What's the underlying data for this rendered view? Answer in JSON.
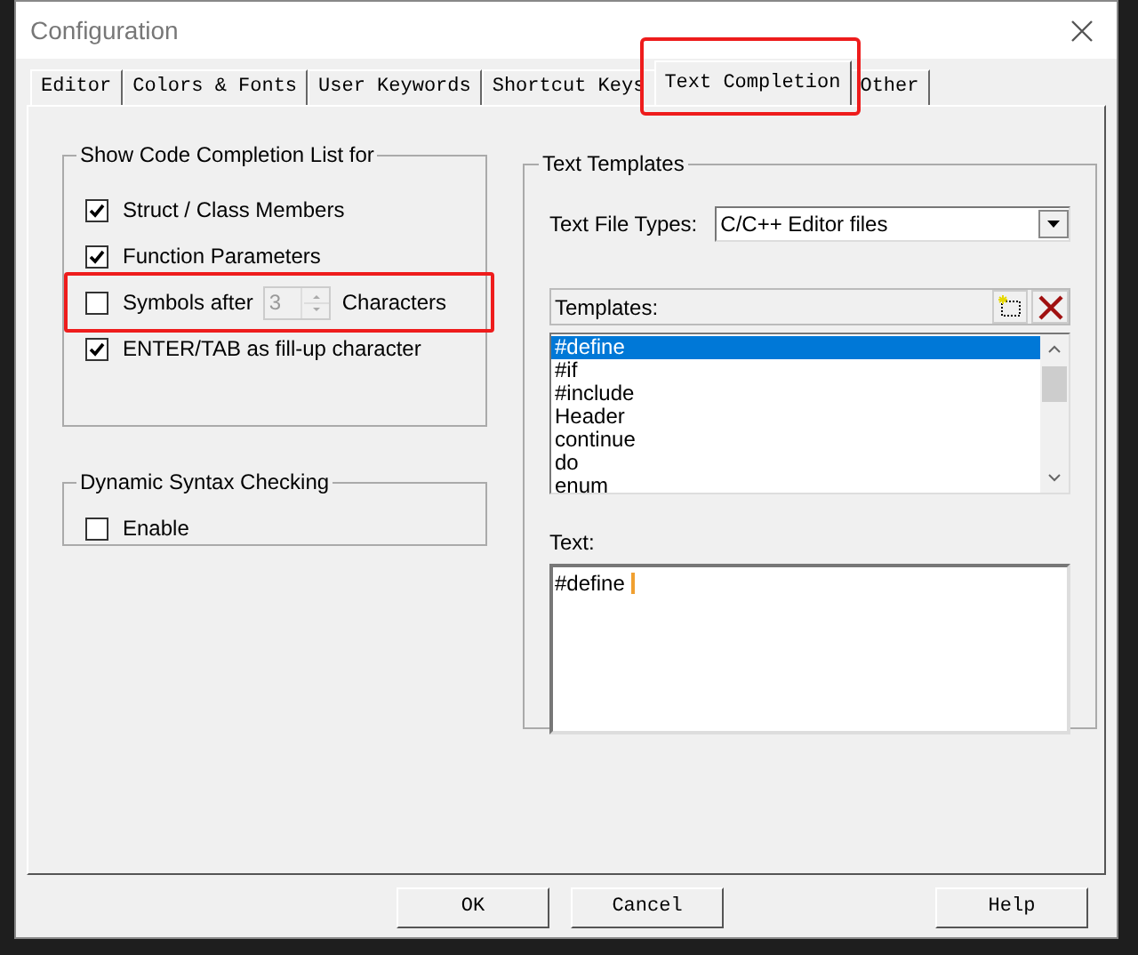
{
  "window": {
    "title": "Configuration"
  },
  "tabs": [
    {
      "label": "Editor",
      "selected": false,
      "highlighted": false
    },
    {
      "label": "Colors & Fonts",
      "selected": false,
      "highlighted": false
    },
    {
      "label": "User Keywords",
      "selected": false,
      "highlighted": false
    },
    {
      "label": "Shortcut Keys",
      "selected": false,
      "highlighted": false
    },
    {
      "label": "Text Completion",
      "selected": true,
      "highlighted": true
    },
    {
      "label": "Other",
      "selected": false,
      "highlighted": false
    }
  ],
  "code_completion": {
    "title": "Show Code Completion List for",
    "options": [
      {
        "kind": "checkbox",
        "label": "Struct / Class Members",
        "checked": true,
        "highlighted": false
      },
      {
        "kind": "checkbox",
        "label": "Function Parameters",
        "checked": true,
        "highlighted": false
      },
      {
        "kind": "spin",
        "label": "Symbols after",
        "value": "3",
        "suffix": "Characters",
        "checked": false,
        "disabled": true,
        "highlighted": true
      },
      {
        "kind": "checkbox",
        "label": "ENTER/TAB as fill-up character",
        "checked": true,
        "highlighted": false
      }
    ]
  },
  "syntax_checking": {
    "title": "Dynamic Syntax Checking",
    "options": [
      {
        "kind": "checkbox",
        "label": "Enable",
        "checked": false,
        "highlighted": false
      }
    ]
  },
  "text_templates": {
    "title": "Text Templates",
    "file_types": {
      "label": "Text File Types:",
      "value": "C/C++ Editor files"
    },
    "templates": {
      "label": "Templates:",
      "items": [
        {
          "label": "#define",
          "selected": true
        },
        {
          "label": "#if",
          "selected": false
        },
        {
          "label": "#include",
          "selected": false
        },
        {
          "label": "Header",
          "selected": false
        },
        {
          "label": "continue",
          "selected": false
        },
        {
          "label": "do",
          "selected": false
        },
        {
          "label": "enum",
          "selected": false
        }
      ]
    },
    "text": {
      "label": "Text:",
      "value": "#define "
    }
  },
  "buttons": [
    {
      "label": "OK"
    },
    {
      "label": "Cancel"
    },
    {
      "label": "Help"
    }
  ]
}
